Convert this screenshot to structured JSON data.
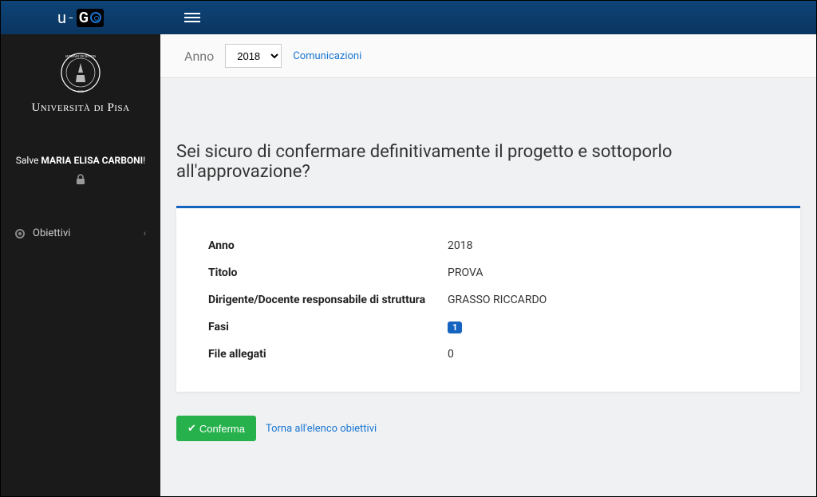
{
  "topbar": {
    "logo_u": "u",
    "logo_dash": "-",
    "logo_g": "G"
  },
  "sidebar": {
    "university_name": "Università di Pisa",
    "greeting_prefix": "Salve ",
    "greeting_name": "MARIA ELISA CARBONI",
    "greeting_suffix": "!",
    "nav": {
      "obiettivi": "Obiettivi"
    }
  },
  "toolbar": {
    "anno_label": "Anno",
    "year_selected": "2018",
    "comunicazioni": "Comunicazioni"
  },
  "page": {
    "title": "Sei sicuro di confermare definitivamente il progetto e sottoporlo all'approvazione?"
  },
  "details": {
    "anno": {
      "label": "Anno",
      "value": "2018"
    },
    "titolo": {
      "label": "Titolo",
      "value": "PROVA"
    },
    "dirigente": {
      "label": "Dirigente/Docente responsabile di struttura",
      "value": "GRASSO RICCARDO"
    },
    "fasi": {
      "label": "Fasi",
      "value": "1"
    },
    "allegati": {
      "label": "File allegati",
      "value": "0"
    }
  },
  "actions": {
    "confirm": "Conferma",
    "back": "Torna all'elenco obiettivi"
  }
}
